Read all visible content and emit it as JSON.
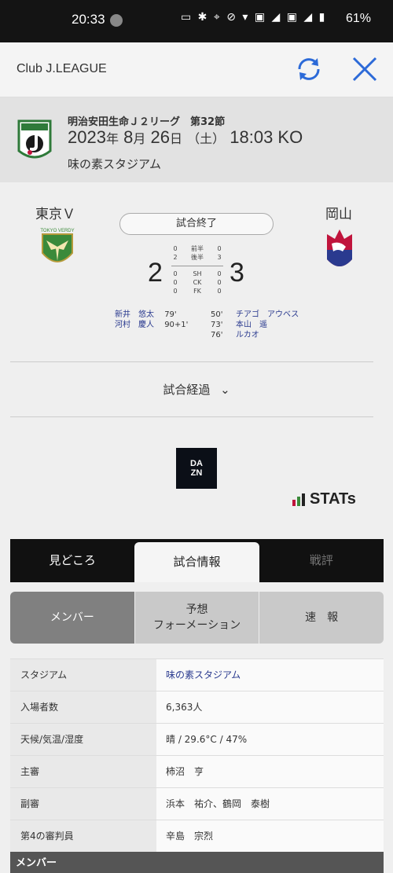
{
  "status_bar": {
    "time": "20:33",
    "battery": "61%"
  },
  "app_bar": {
    "title": "Club J.LEAGUE"
  },
  "match": {
    "league": "明治安田生命Ｊ２リーグ　第32節",
    "year": "2023",
    "year_suffix": "年",
    "month": "8",
    "month_suffix": "月",
    "day": "26",
    "day_suffix": "日",
    "weekday": "（土）",
    "kickoff": "18:03 KO",
    "venue": "味の素スタジアム",
    "status": "試合終了",
    "home": {
      "name": "東京Ｖ",
      "score": "2"
    },
    "away": {
      "name": "岡山",
      "score": "3"
    },
    "stats": [
      {
        "home": "0",
        "label": "前半",
        "away": "0"
      },
      {
        "home": "2",
        "label": "後半",
        "away": "3"
      },
      {
        "home": "0",
        "label": "SH",
        "away": "0"
      },
      {
        "home": "0",
        "label": "CK",
        "away": "0"
      },
      {
        "home": "0",
        "label": "FK",
        "away": "0"
      }
    ],
    "home_scorers": [
      {
        "name": "新井　悠太",
        "time": "79'"
      },
      {
        "name": "河村　慶人",
        "time": "90+1'"
      }
    ],
    "away_scorers": [
      {
        "time": "50'",
        "name": "チアゴ　アウベス"
      },
      {
        "time": "73'",
        "name": "本山　遥"
      },
      {
        "time": "76'",
        "name": "ルカオ"
      }
    ],
    "progress_label": "試合経過",
    "progress_chevron": "⌄"
  },
  "sponsors": {
    "dazn_line1": "DA",
    "dazn_line2": "ZN",
    "stats_text": "STATs"
  },
  "tabs": [
    {
      "label": "見どころ"
    },
    {
      "label": "試合情報"
    },
    {
      "label": "戦評"
    }
  ],
  "subtabs": [
    {
      "label": "メンバー"
    },
    {
      "label_line1": "予想",
      "label_line2": "フォーメーション"
    },
    {
      "label": "速　報"
    }
  ],
  "info": [
    {
      "key": "スタジアム",
      "value": "味の素スタジアム"
    },
    {
      "key": "入場者数",
      "value": "6,363人"
    },
    {
      "key": "天候/気温/湿度",
      "value": "晴 / 29.6°C / 47%"
    },
    {
      "key": "主審",
      "value": "柿沼　亨"
    },
    {
      "key": "副審",
      "value": "浜本　祐介、鶴岡　泰樹"
    },
    {
      "key": "第4の審判員",
      "value": "辛島　宗烈"
    }
  ],
  "members_header": "メンバー",
  "colors": {
    "verdy_green": "#3b8a3a",
    "okayama_red": "#c0143c",
    "link_blue": "#2a3a8f"
  }
}
